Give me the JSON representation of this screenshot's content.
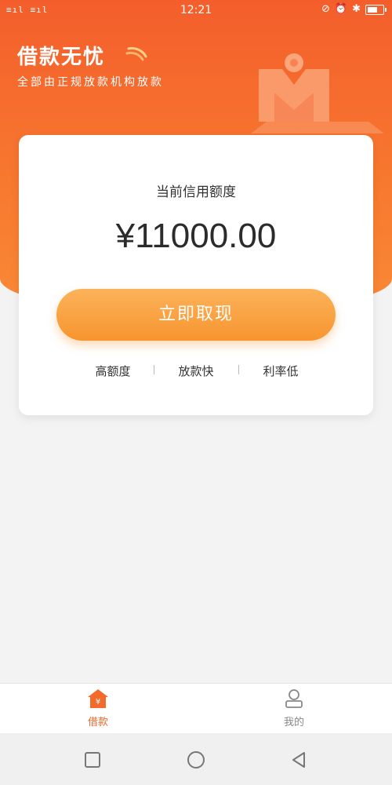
{
  "status_bar": {
    "signal_text": "图.ıl °決.ıl",
    "time": "12:21"
  },
  "header": {
    "title": "借款无忧",
    "subtitle": "全部由正规放款机构放款"
  },
  "card": {
    "credit_label": "当前信用额度",
    "credit_amount": "¥11000.00",
    "withdraw_button": "立即取现",
    "features": [
      "高额度",
      "放款快",
      "利率低"
    ]
  },
  "tabbar": {
    "tabs": [
      {
        "label": "借款",
        "icon": "loan-home-icon",
        "active": true
      },
      {
        "label": "我的",
        "icon": "user-icon",
        "active": false
      }
    ]
  },
  "colors": {
    "brand_orange": "#f45e2c",
    "button_orange": "#f7952f",
    "active_tab": "#f26a2c"
  }
}
